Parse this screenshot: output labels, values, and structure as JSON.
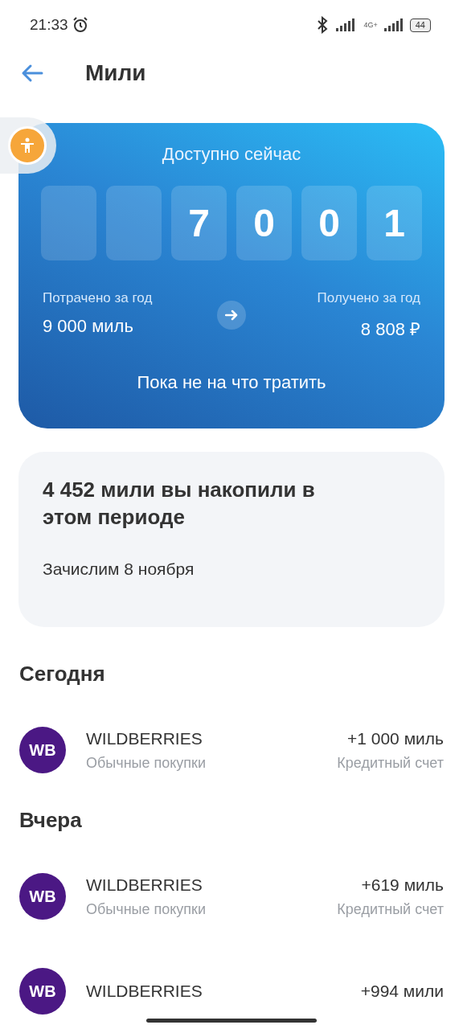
{
  "status_bar": {
    "time": "21:33",
    "network": "4G+",
    "battery": "44"
  },
  "header": {
    "title": "Мили"
  },
  "miles_card": {
    "title": "Доступно сейчас",
    "digits": [
      "7",
      "0",
      "0",
      "1"
    ],
    "spent": {
      "label": "Потрачено за год",
      "value": "9 000 миль"
    },
    "received": {
      "label": "Получено за год",
      "value": "8 808 ₽"
    },
    "message": "Пока не на что тратить"
  },
  "summary": {
    "title": "4 452 мили вы накопили в этом периоде",
    "note": "Зачислим 8 ноября"
  },
  "sections": [
    {
      "title": "Сегодня",
      "transactions": [
        {
          "logo": "WB",
          "merchant": "WILDBERRIES",
          "category": "Обычные покупки",
          "amount": "+1 000 миль",
          "account": "Кредитный счет"
        }
      ]
    },
    {
      "title": "Вчера",
      "transactions": [
        {
          "logo": "WB",
          "merchant": "WILDBERRIES",
          "category": "Обычные покупки",
          "amount": "+619 миль",
          "account": "Кредитный счет"
        },
        {
          "logo": "WB",
          "merchant": "WILDBERRIES",
          "amount": "+994 мили"
        }
      ]
    }
  ]
}
